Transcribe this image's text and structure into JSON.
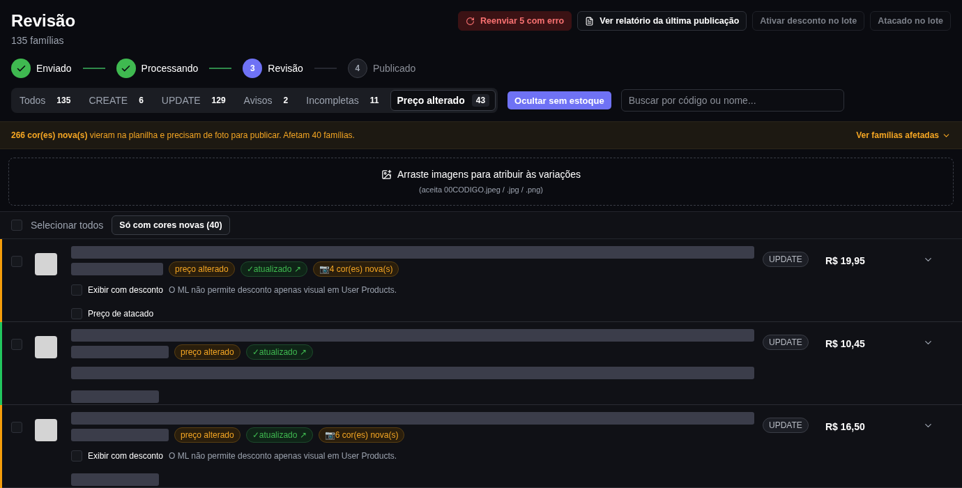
{
  "header": {
    "title": "Revisão",
    "subtitle": "135 famílias",
    "actions": [
      {
        "label": "Reenviar 5 com erro",
        "kind": "danger"
      },
      {
        "label": "Ver relatório da última publicação",
        "kind": "report"
      },
      {
        "label": "Ativar desconto no lote",
        "kind": "muted"
      },
      {
        "label": "Atacado no lote",
        "kind": "muted"
      }
    ]
  },
  "steps": [
    {
      "label": "Enviado",
      "done": true,
      "current": false
    },
    {
      "label": "Processando",
      "done": true,
      "current": false
    },
    {
      "label": "Revisão",
      "number": "3",
      "done": false,
      "current": true
    },
    {
      "label": "Publicado",
      "number": "4",
      "done": false,
      "current": false
    }
  ],
  "filters": [
    {
      "label": "Todos",
      "count": "135",
      "selected": false
    },
    {
      "label": "CREATE",
      "count": "6",
      "selected": false
    },
    {
      "label": "UPDATE",
      "count": "129",
      "selected": false
    },
    {
      "label": "Avisos",
      "count": "2",
      "selected": false
    },
    {
      "label": "Incompletas",
      "count": "11",
      "selected": false
    },
    {
      "label": "Preço alterado",
      "count": "43",
      "selected": true
    }
  ],
  "hide_button": {
    "label": "Ocultar sem estoque",
    "on": true
  },
  "search": {
    "placeholder": "Buscar por código ou nome..."
  },
  "warning": {
    "text": "**266 cor(es) nova(s)** vieram na planilha e precisam de foto para publicar. Afetam 40 famílias.",
    "link": "Ver famílias afetadas"
  },
  "dropzone": {
    "title": "Arraste imagens para atribuir às variações",
    "hint": "(aceita 00CODIGO.jpeg / .jpg / .png)"
  },
  "selection": {
    "label": "Selecionar todos",
    "checked": false,
    "filter": "Só com cores novas (40)"
  },
  "rows": [
    {
      "color": "#f59e0b",
      "checked": false,
      "type": "UPDATE",
      "price": "R$ 19,95",
      "tags": [
        {
          "kind": "price",
          "text": "preço alterado"
        },
        {
          "kind": "updated",
          "text": "✓atualizado ↗"
        },
        {
          "kind": "colors",
          "text": "📷4 cor(es) nova(s)"
        }
      ],
      "options": [
        {
          "kind": "text",
          "label": "Exibir com desconto",
          "note": "O ML não permite desconto apenas visual em User Products.",
          "checked": false
        },
        {
          "kind": "text",
          "label": "Preço de atacado",
          "checked": false
        }
      ]
    },
    {
      "color": "#22c55e",
      "checked": false,
      "type": "UPDATE",
      "price": "R$ 10,45",
      "tags": [
        {
          "kind": "price",
          "text": "preço alterado"
        },
        {
          "kind": "updated",
          "text": "✓atualizado ↗"
        }
      ],
      "options": [
        {
          "kind": "redacted"
        },
        {
          "kind": "redacted"
        }
      ]
    },
    {
      "color": "#f59e0b",
      "checked": false,
      "type": "UPDATE",
      "price": "R$ 16,50",
      "tags": [
        {
          "kind": "price",
          "text": "preço alterado"
        },
        {
          "kind": "updated",
          "text": "✓atualizado ↗"
        },
        {
          "kind": "colors",
          "text": "📷6 cor(es) nova(s)"
        }
      ],
      "options": [
        {
          "kind": "text",
          "label": "Exibir com desconto",
          "note": "O ML não permite desconto apenas visual em User Products.",
          "checked": false
        },
        {
          "kind": "redacted"
        }
      ]
    }
  ]
}
